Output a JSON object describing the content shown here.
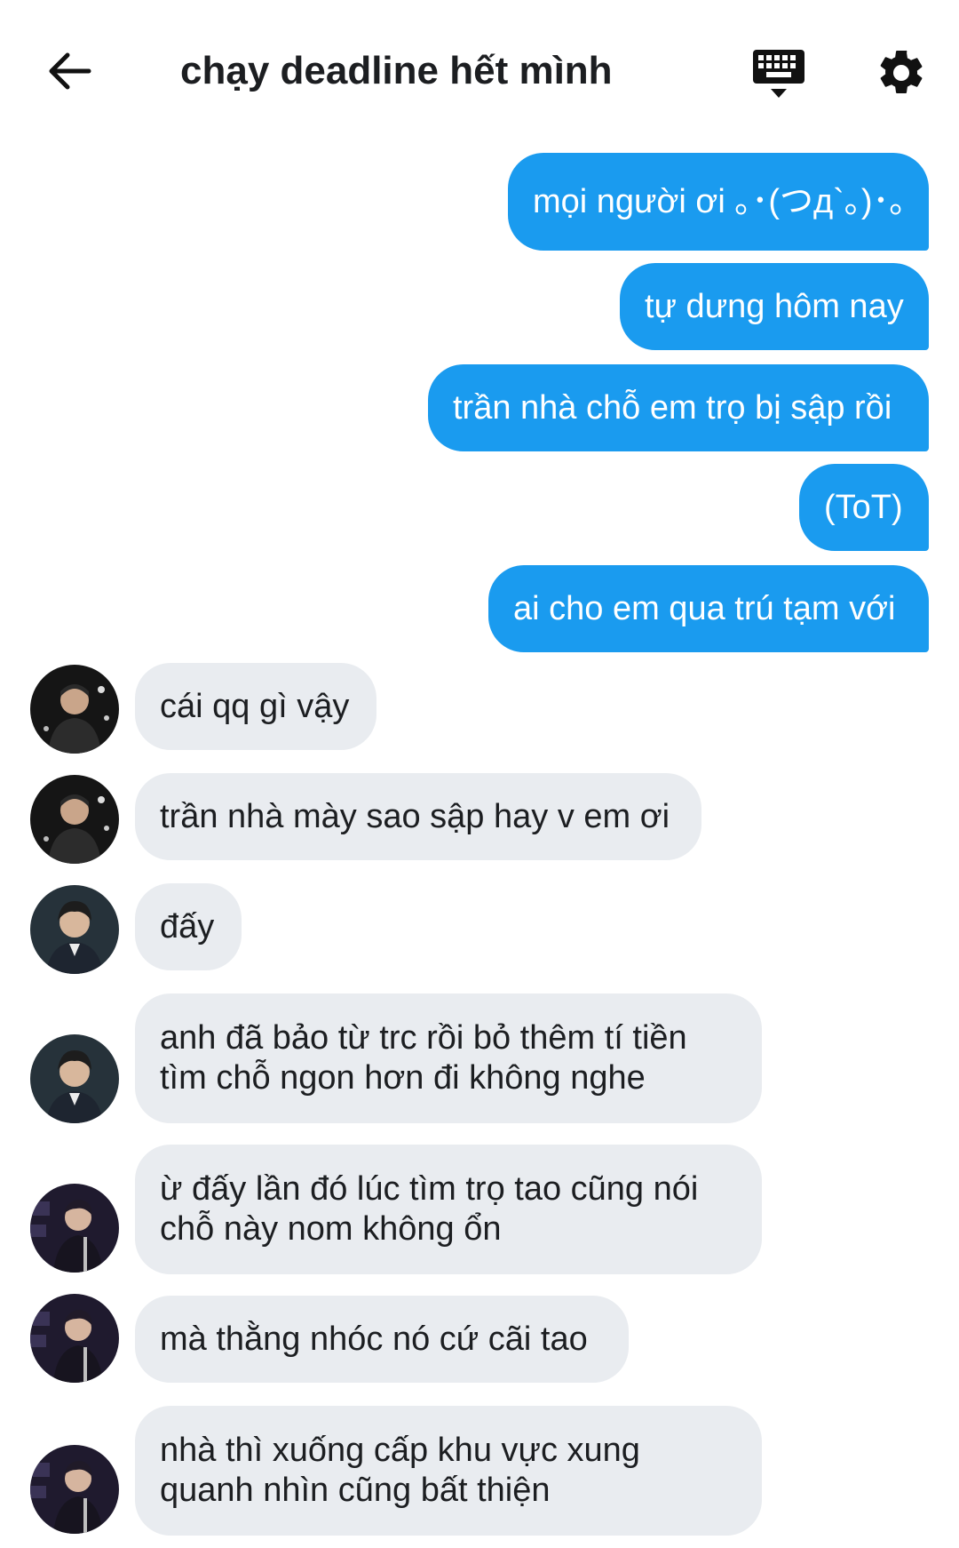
{
  "header": {
    "title": "chạy deadline hết mình"
  },
  "messages": {
    "outgoing": [
      "mọi người ơi ｡･(つд`｡)･｡",
      "tự dưng hôm nay",
      "trần nhà chỗ em trọ bị sập rồi",
      "(ToT)",
      "ai cho em qua trú tạm với"
    ],
    "incoming": [
      {
        "text": "cái qq gì vậy",
        "avatar": "avatar-user-a"
      },
      {
        "text": "trần nhà mày sao sập hay v em ơi",
        "avatar": "avatar-user-a"
      },
      {
        "text": "đấy",
        "avatar": "avatar-user-b"
      },
      {
        "text": "anh đã bảo từ trc rồi bỏ thêm tí tiền tìm chỗ ngon hơn đi không nghe",
        "avatar": "avatar-user-b"
      },
      {
        "text": "ừ đấy lần đó lúc tìm trọ tao cũng nói chỗ này nom không ổn",
        "avatar": "avatar-user-c"
      },
      {
        "text": "mà thằng nhóc nó cứ cãi tao",
        "avatar": "avatar-user-c"
      },
      {
        "text": "nhà thì xuống cấp khu vực xung quanh nhìn cũng bất thiện",
        "avatar": "avatar-user-c"
      }
    ]
  },
  "colors": {
    "outgoing_bubble": "#1a9bef",
    "incoming_bubble": "#e9ecf0",
    "icons": "#111111"
  },
  "icons": {
    "back": "arrow-left-icon",
    "keyboard": "keyboard-icon",
    "settings": "gear-icon"
  }
}
